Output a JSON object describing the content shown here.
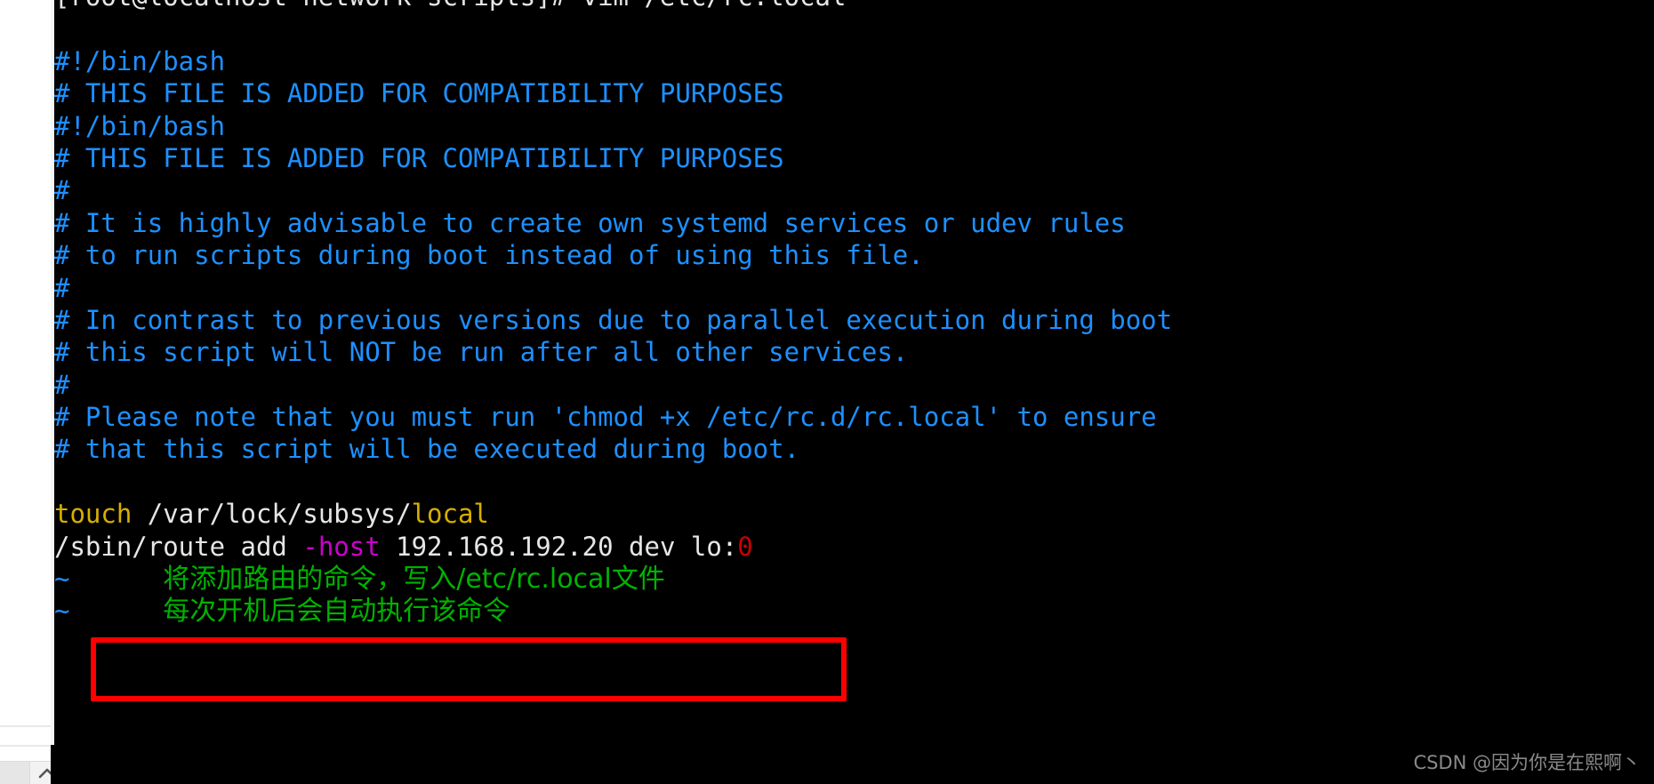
{
  "app": {
    "kind": "terminal-vim-session",
    "shell_prompt": "[root@localhost network-scripts]# vim /etc/rc.local",
    "background_color": "#000000",
    "foreground_color": "#e6e6e6"
  },
  "colors": {
    "comment_blue": "#1e90ff",
    "command_yellow": "#d7af00",
    "option_magenta": "#cc00cc",
    "number_red": "#cc0000",
    "annotation_green": "#00b300",
    "highlight_box_red": "#ff0000",
    "watermark_gray": "#8a8a8a"
  },
  "editor": {
    "file": "/etc/rc.local",
    "lines": [
      {
        "id": "prompt",
        "segments": [
          {
            "text": "[root@localhost network-scripts]# vim /etc/rc.local",
            "color": "white"
          }
        ]
      },
      {
        "id": "blank1",
        "segments": [
          {
            "text": "",
            "color": "white"
          }
        ]
      },
      {
        "id": "l-shebang-1",
        "segments": [
          {
            "text": "#!/bin/bash",
            "color": "comment"
          }
        ]
      },
      {
        "id": "l-compat-1",
        "segments": [
          {
            "text": "# THIS FILE IS ADDED FOR COMPATIBILITY PURPOSES",
            "color": "comment"
          }
        ]
      },
      {
        "id": "l-shebang-2",
        "segments": [
          {
            "text": "#!/bin/bash",
            "color": "comment"
          }
        ]
      },
      {
        "id": "l-compat-2",
        "segments": [
          {
            "text": "# THIS FILE IS ADDED FOR COMPATIBILITY PURPOSES",
            "color": "comment"
          }
        ]
      },
      {
        "id": "l-hash-1",
        "segments": [
          {
            "text": "#",
            "color": "comment"
          }
        ]
      },
      {
        "id": "l-advisable",
        "segments": [
          {
            "text": "# It is highly advisable to create own systemd services or udev rules",
            "color": "comment"
          }
        ]
      },
      {
        "id": "l-torun",
        "segments": [
          {
            "text": "# to run scripts during boot instead of using this file.",
            "color": "comment"
          }
        ]
      },
      {
        "id": "l-hash-2",
        "segments": [
          {
            "text": "#",
            "color": "comment"
          }
        ]
      },
      {
        "id": "l-incontrast",
        "segments": [
          {
            "text": "# In contrast to previous versions due to parallel execution during boot",
            "color": "comment"
          }
        ]
      },
      {
        "id": "l-notrun",
        "segments": [
          {
            "text": "# this script will NOT be run after all other services.",
            "color": "comment"
          }
        ]
      },
      {
        "id": "l-hash-3",
        "segments": [
          {
            "text": "#",
            "color": "comment"
          }
        ]
      },
      {
        "id": "l-please",
        "segments": [
          {
            "text": "# Please note that you must run 'chmod +x /etc/rc.d/rc.local' to ensure",
            "color": "comment"
          }
        ]
      },
      {
        "id": "l-thatthis",
        "segments": [
          {
            "text": "# that this script will be executed during boot.",
            "color": "comment"
          }
        ]
      },
      {
        "id": "blank2",
        "segments": [
          {
            "text": "",
            "color": "white"
          }
        ]
      },
      {
        "id": "l-touch",
        "segments": [
          {
            "text": "touch",
            "color": "yellow"
          },
          {
            "text": " /var/lock/subsys/",
            "color": "white"
          },
          {
            "text": "local",
            "color": "yellow"
          }
        ]
      },
      {
        "id": "l-route",
        "segments": [
          {
            "text": "/sbin/route add ",
            "color": "white"
          },
          {
            "text": "-host",
            "color": "magenta"
          },
          {
            "text": " 192.168.192.20 dev lo:",
            "color": "white"
          },
          {
            "text": "0",
            "color": "red"
          }
        ]
      },
      {
        "id": "l-tilde-1",
        "segments": [
          {
            "text": "~",
            "color": "tilde"
          },
          {
            "text": "      ",
            "color": "white"
          },
          {
            "text": "将添加路由的命令，写入/etc/rc.local文件",
            "color": "green",
            "cjk": true
          }
        ]
      },
      {
        "id": "l-tilde-2",
        "segments": [
          {
            "text": "~",
            "color": "tilde"
          },
          {
            "text": "      ",
            "color": "white"
          },
          {
            "text": "每次开机后会自动执行该命令",
            "color": "green",
            "cjk": true
          }
        ]
      }
    ]
  },
  "annotations": {
    "highlight_box": {
      "label": "red-highlight-rectangle",
      "targets_line": "/sbin/route add -host 192.168.192.20 dev lo:0"
    },
    "green_notes": [
      "将添加路由的命令，写入/etc/rc.local文件",
      "每次开机后会自动执行该命令"
    ]
  },
  "watermark": {
    "text": "CSDN @因为你是在熙啊丶"
  },
  "page_chrome": {
    "scroll_top_icon": "chevron-up-icon"
  }
}
